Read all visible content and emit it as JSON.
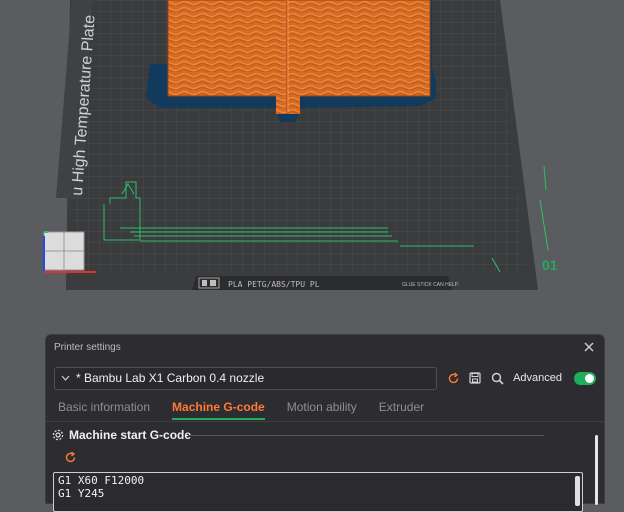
{
  "plate": {
    "label": "u High Temperature Plate",
    "plate_number": "01",
    "strip_left": "PLA PETG/ABS/TPU PL",
    "strip_right": "GLUE STICK CAN HELP."
  },
  "dialog": {
    "title": "Printer settings",
    "printer_name": "* Bambu Lab X1 Carbon 0.4 nozzle",
    "advanced_label": "Advanced",
    "advanced_on": true,
    "tabs": [
      {
        "label": "Basic information",
        "active": false
      },
      {
        "label": "Machine G-code",
        "active": true
      },
      {
        "label": "Motion ability",
        "active": false
      },
      {
        "label": "Extruder",
        "active": false
      }
    ],
    "section_title": "Machine start G-code",
    "gcode_lines": [
      "G1 X60 F12000",
      "G1 Y245"
    ]
  },
  "colors": {
    "accent_orange": "#ff7a35",
    "accent_green": "#1fae5b",
    "dialog_bg": "#2d2d31"
  }
}
